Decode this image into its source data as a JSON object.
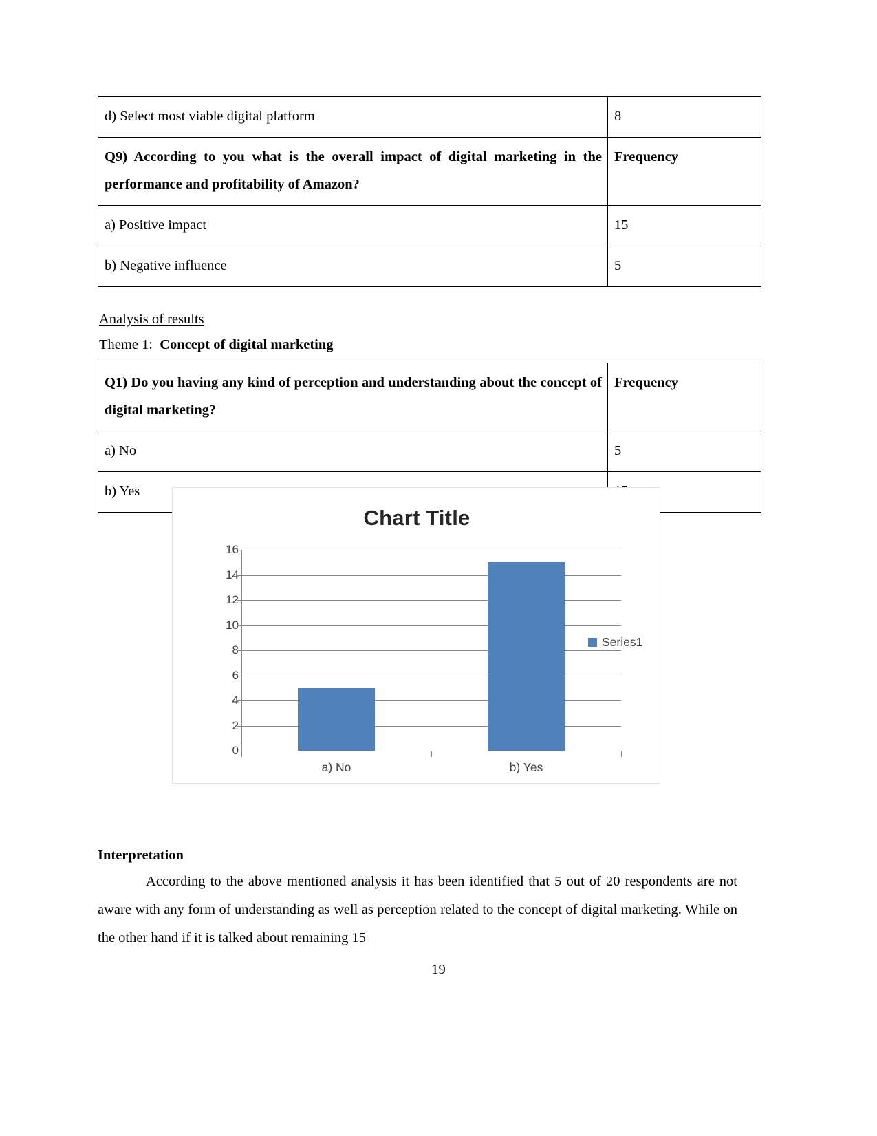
{
  "document": {
    "page_number": "19",
    "tables": [
      {
        "name": "q9-table",
        "rows": [
          {
            "question": "d) Select most viable digital platform",
            "frequency": "8",
            "bold": false,
            "tall": false
          },
          {
            "question": "Q9) According to you what is the overall impact of digital marketing in the performance and profitability of Amazon?",
            "frequency": "Frequency",
            "bold": true,
            "tall": true
          },
          {
            "question": "a) Positive impact",
            "frequency": "15",
            "bold": false,
            "tall": false
          },
          {
            "question": "b) Negative influence",
            "frequency": "5",
            "bold": false,
            "tall": false
          }
        ]
      },
      {
        "name": "q1-table",
        "rows": [
          {
            "question": "Q1) Do you having any kind of perception and understanding about the concept of digital marketing?",
            "frequency": "Frequency",
            "bold": true,
            "tall": true
          },
          {
            "question": "a) No",
            "frequency": "5",
            "bold": false,
            "tall": false
          },
          {
            "question": "b) Yes",
            "frequency": "15",
            "bold": false,
            "tall": false
          }
        ]
      }
    ],
    "analysis_heading": "Analysis of results",
    "theme": {
      "label": "Theme 1:",
      "value": "Concept of digital marketing"
    },
    "interpretation": {
      "heading": "Interpretation",
      "paragraph": "According to the above mentioned analysis it has been identified that 5 out of 20 respondents are not aware with any form of understanding as well as perception related to the concept of digital marketing. While on the other hand if it is talked about remaining 15"
    }
  },
  "chart_data": {
    "type": "bar",
    "title": "Chart Title",
    "categories": [
      "a) No",
      "b) Yes"
    ],
    "values": [
      5,
      15
    ],
    "series": [
      {
        "name": "Series1",
        "values": [
          5,
          15
        ]
      }
    ],
    "legend": [
      "Series1"
    ],
    "legend_position": "right",
    "xlabel": "",
    "ylabel": "",
    "ylim": [
      0,
      16
    ],
    "ytick_step": 2,
    "yticks": [
      "16",
      "14",
      "12",
      "10",
      "8",
      "6",
      "4",
      "2",
      "0"
    ],
    "grid": true,
    "bar_color": "#4F81BD",
    "axis_color": "#868686"
  }
}
